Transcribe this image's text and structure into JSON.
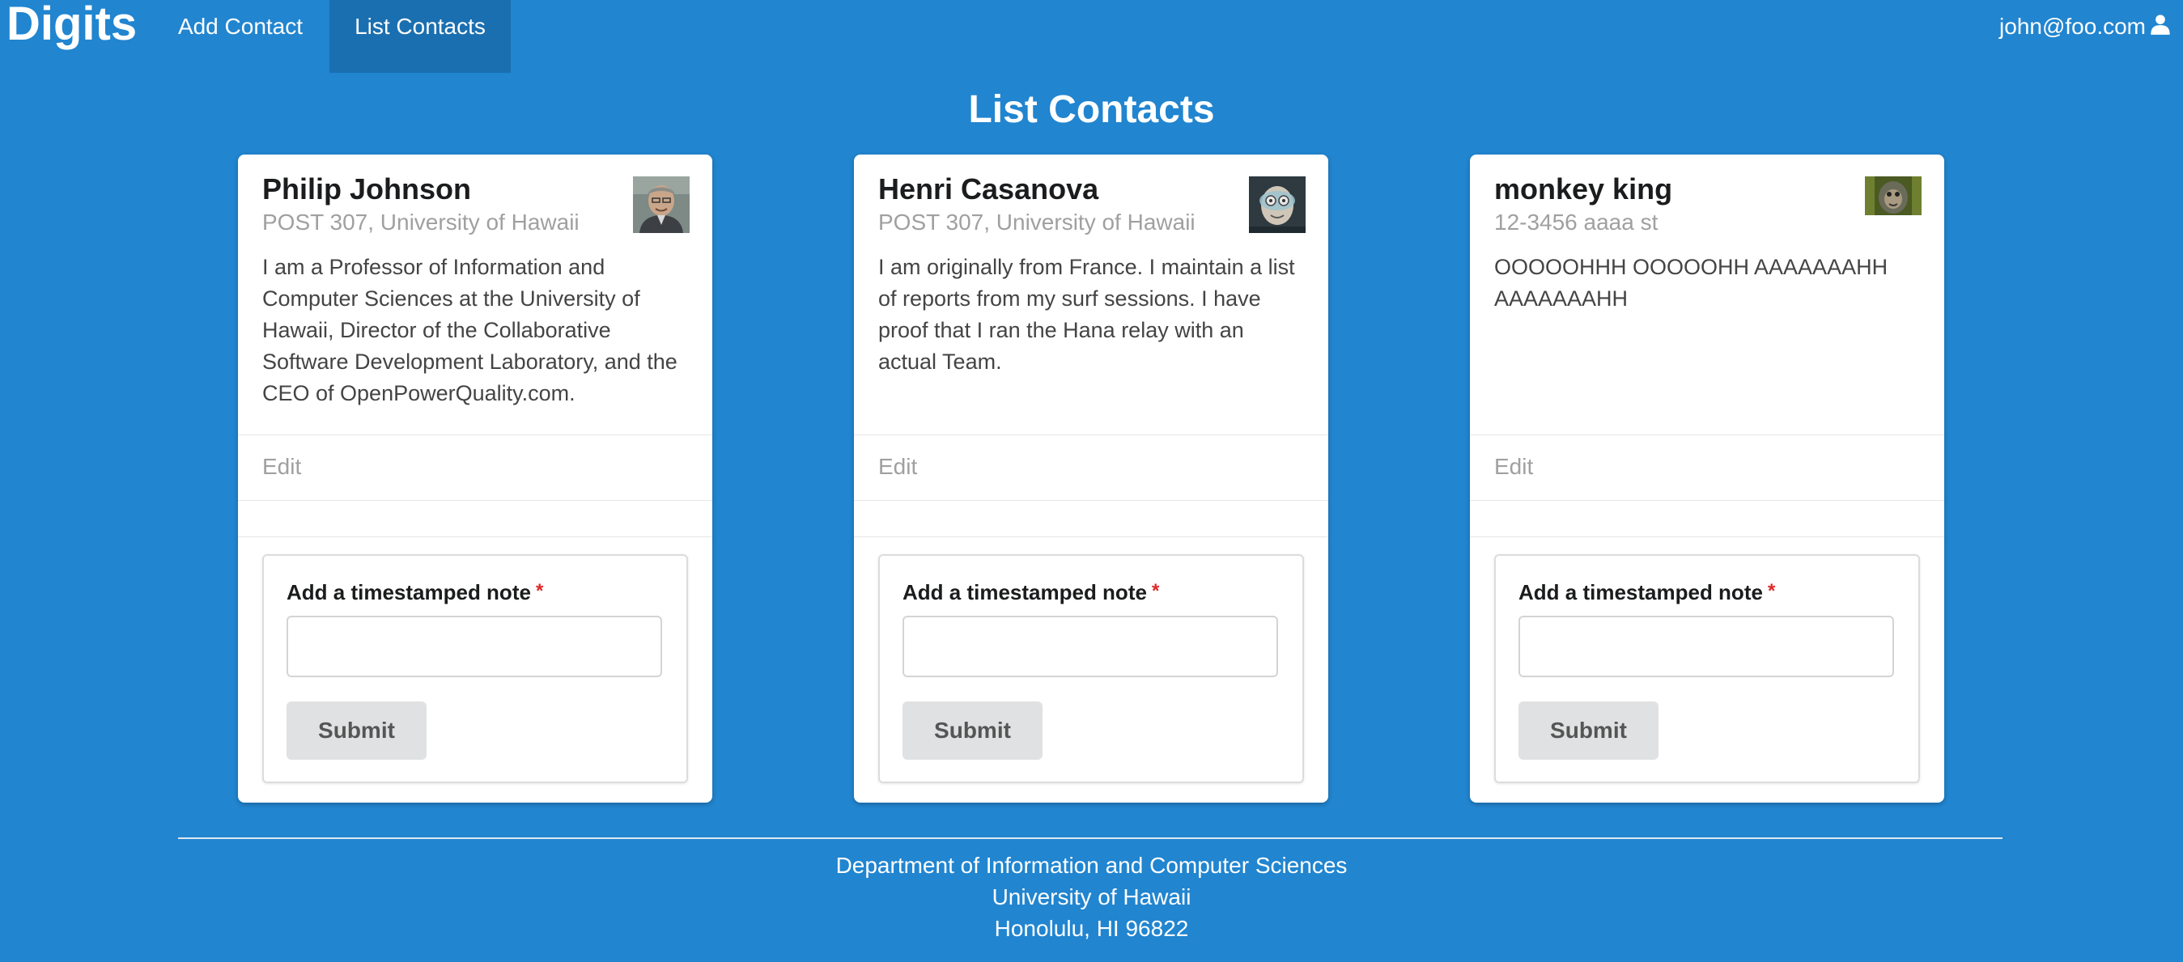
{
  "navbar": {
    "brand": "Digits",
    "add_contact": "Add Contact",
    "list_contacts": "List Contacts",
    "user": "john@foo.com"
  },
  "page": {
    "title": "List Contacts"
  },
  "contacts": [
    {
      "name": "Philip Johnson",
      "address": "POST 307, University of Hawaii",
      "description": "I am a Professor of Information and Computer Sciences at the University of Hawaii, Director of the Collaborative Software Development Laboratory, and the CEO of OpenPowerQuality.com.",
      "edit": "Edit",
      "note_label": "Add a timestamped note",
      "required_mark": "*",
      "note_value": "",
      "submit": "Submit"
    },
    {
      "name": "Henri Casanova",
      "address": "POST 307, University of Hawaii",
      "description": "I am originally from France. I maintain a list of reports from my surf sessions. I have proof that I ran the Hana relay with an actual Team.",
      "edit": "Edit",
      "note_label": "Add a timestamped note",
      "required_mark": "*",
      "note_value": "",
      "submit": "Submit"
    },
    {
      "name": "monkey king",
      "address": "12-3456 aaaa st",
      "description": "OOOOOHHH OOOOOHH AAAAAAAHH AAAAAAAHH",
      "edit": "Edit",
      "note_label": "Add a timestamped note",
      "required_mark": "*",
      "note_value": "",
      "submit": "Submit"
    }
  ],
  "footer": {
    "line1": "Department of Information and Computer Sciences",
    "line2": "University of Hawaii",
    "line3": "Honolulu, HI 96822"
  },
  "colors": {
    "background": "#2185d0",
    "active_nav": "#1a6fb0",
    "required": "#db2828"
  }
}
